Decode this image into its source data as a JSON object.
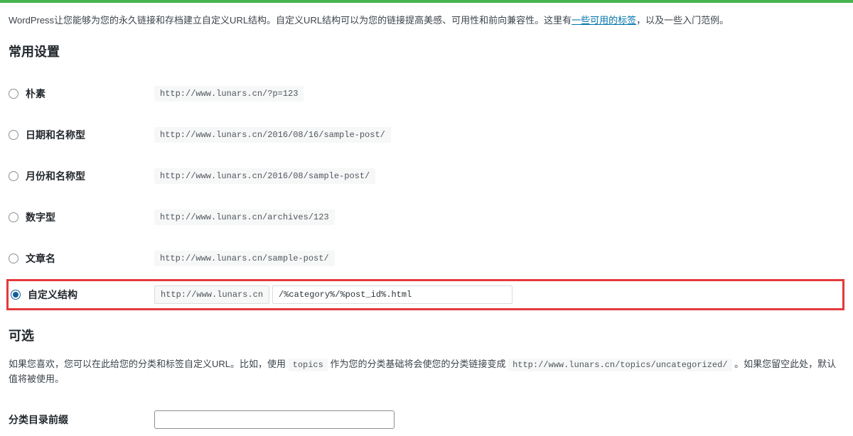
{
  "intro": {
    "text_before": "WordPress让您能够为您的永久链接和存档建立自定义URL结构。自定义URL结构可以为您的链接提高美感、可用性和前向兼容性。这里有",
    "link_text": "一些可用的标签",
    "text_after": "，以及一些入门范例。"
  },
  "section_common_title": "常用设置",
  "options": [
    {
      "label": "朴素",
      "example": "http://www.lunars.cn/?p=123",
      "checked": false
    },
    {
      "label": "日期和名称型",
      "example": "http://www.lunars.cn/2016/08/16/sample-post/",
      "checked": false
    },
    {
      "label": "月份和名称型",
      "example": "http://www.lunars.cn/2016/08/sample-post/",
      "checked": false
    },
    {
      "label": "数字型",
      "example": "http://www.lunars.cn/archives/123",
      "checked": false
    },
    {
      "label": "文章名",
      "example": "http://www.lunars.cn/sample-post/",
      "checked": false
    }
  ],
  "custom": {
    "label": "自定义结构",
    "base": "http://www.lunars.cn",
    "value": "/%category%/%post_id%.html",
    "checked": true
  },
  "section_optional_title": "可选",
  "optional_desc": {
    "p1": "如果您喜欢，您可以在此给您的分类和标签自定义URL。比如，使用 ",
    "code1": "topics",
    "p2": " 作为您的分类基础将会使您的分类链接变成 ",
    "code2": "http://www.lunars.cn/topics/uncategorized/",
    "p3": " 。如果您留空此处，默认值将被使用。"
  },
  "category_prefix": {
    "label": "分类目录前缀",
    "value": ""
  }
}
